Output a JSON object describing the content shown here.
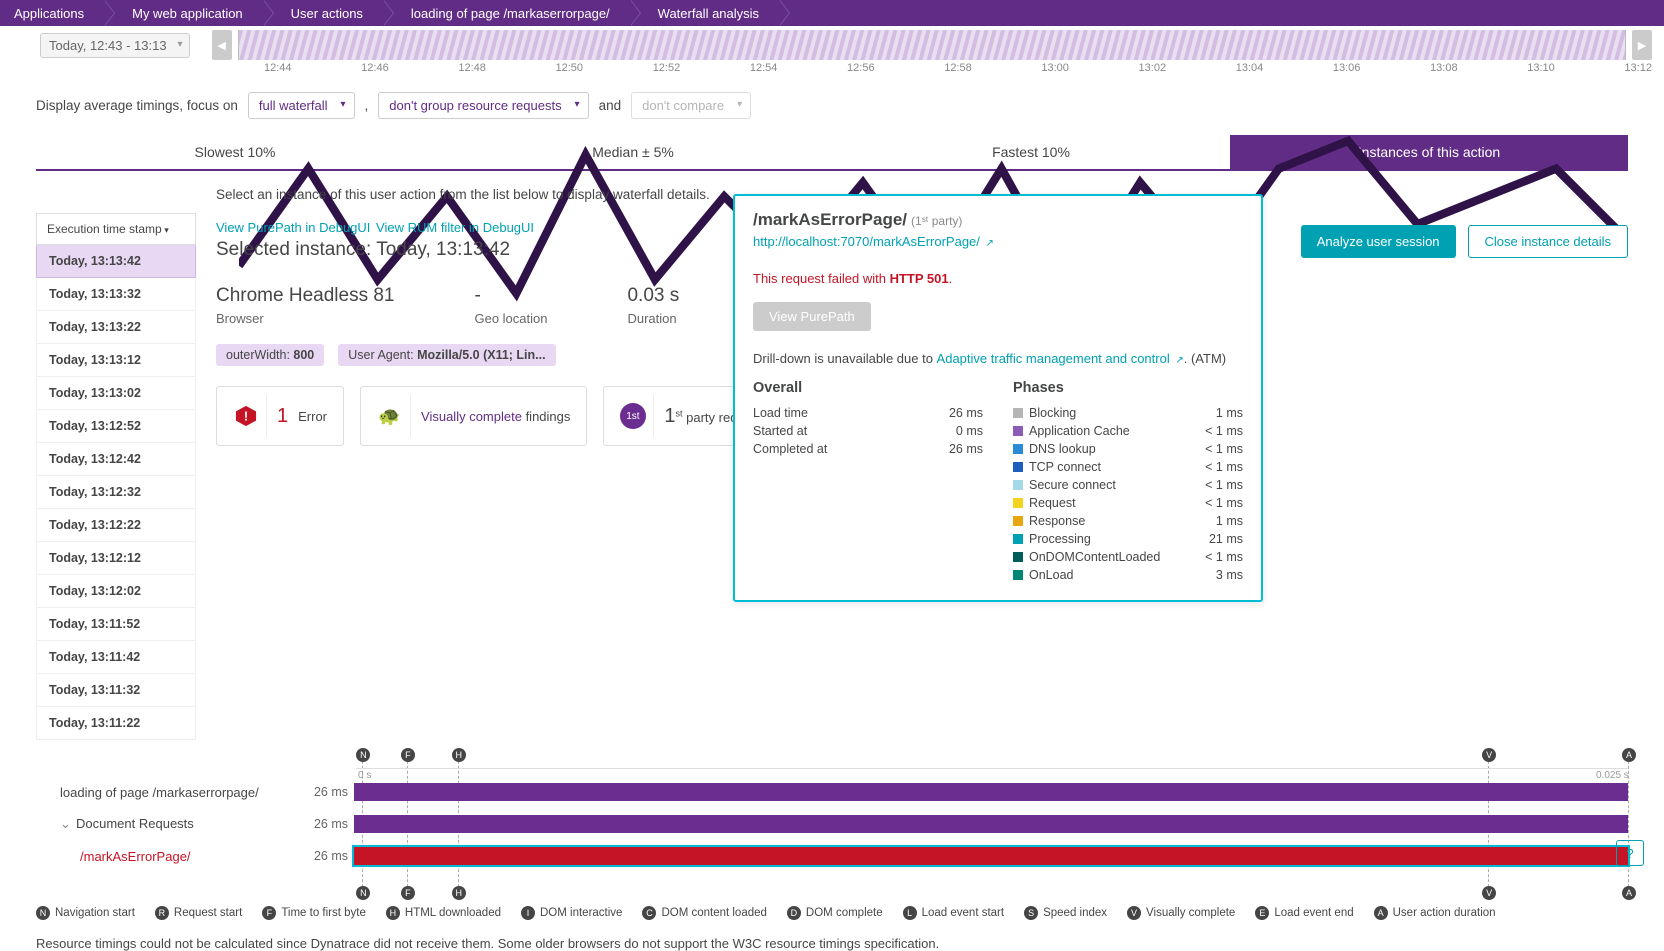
{
  "breadcrumb": [
    "Applications",
    "My web application",
    "User actions",
    "loading of page /markaserrorpage/",
    "Waterfall analysis"
  ],
  "time_selector": "Today, 12:43 - 13:13",
  "time_ticks": [
    "12:44",
    "12:46",
    "12:48",
    "12:50",
    "12:52",
    "12:54",
    "12:56",
    "12:58",
    "13:00",
    "13:02",
    "13:04",
    "13:06",
    "13:08",
    "13:10",
    "13:12"
  ],
  "filter": {
    "prefix": "Display average timings, focus on",
    "waterfall": "full waterfall",
    "group": "don't group resource requests",
    "and": "and",
    "compare": "don't compare",
    "comma": ","
  },
  "tabs": [
    "Slowest 10%",
    "Median ± 5%",
    "Fastest 10%",
    "Instances of this action"
  ],
  "active_tab": 3,
  "instruction": "Select an instance of this user action from the list below to display waterfall details.",
  "list_header": "Execution time stamp",
  "instances": [
    "Today, 13:13:42",
    "Today, 13:13:32",
    "Today, 13:13:22",
    "Today, 13:13:12",
    "Today, 13:13:02",
    "Today, 13:12:52",
    "Today, 13:12:42",
    "Today, 13:12:32",
    "Today, 13:12:22",
    "Today, 13:12:12",
    "Today, 13:12:02",
    "Today, 13:11:52",
    "Today, 13:11:42",
    "Today, 13:11:32",
    "Today, 13:11:22"
  ],
  "selected_index": 0,
  "links": {
    "purepath": "View PurePath in DebugUI",
    "rum": "View RUM filter in DebugUI"
  },
  "selected_label": "Selected instance: Today, 13:13:42",
  "info": {
    "browser_val": "Chrome Headless 81",
    "browser_lbl": "Browser",
    "geo_val": "-",
    "geo_lbl": "Geo location",
    "dur_val": "0.03 s",
    "dur_lbl": "Duration"
  },
  "tags": {
    "outer_key": "outerWidth:",
    "outer_val": "800",
    "ua_key": "User Agent:",
    "ua_val": "Mozilla/5.0 (X11; Lin..."
  },
  "cards": {
    "error_n": "1",
    "error_l": "Error",
    "vc": "Visually complete",
    "vc_sub": "findings",
    "first_badge": "1st",
    "first_count": "1",
    "first_sup": "st",
    "first_txt": " party requests"
  },
  "buttons": {
    "analyze": "Analyze user session",
    "close": "Close instance details",
    "view_pp": "View PurePath"
  },
  "wf": {
    "scale_left": "0 s",
    "scale_right": "0.025 s",
    "r1_label": "loading of page /markaserrorpage/",
    "r1_ms": "26 ms",
    "r2_label": "Document Requests",
    "r2_ms": "26 ms",
    "r3_label": "/markAsErrorPage/",
    "r3_ms": "26 ms",
    "markers": [
      {
        "id": "N",
        "pct": 0.5
      },
      {
        "id": "F",
        "pct": 4
      },
      {
        "id": "H",
        "pct": 8
      },
      {
        "id": "V",
        "pct": 89
      },
      {
        "id": "A",
        "pct": 100
      }
    ]
  },
  "legend": [
    {
      "k": "N",
      "t": "Navigation start"
    },
    {
      "k": "R",
      "t": "Request start"
    },
    {
      "k": "F",
      "t": "Time to first byte"
    },
    {
      "k": "H",
      "t": "HTML downloaded"
    },
    {
      "k": "I",
      "t": "DOM interactive"
    },
    {
      "k": "C",
      "t": "DOM content loaded"
    },
    {
      "k": "D",
      "t": "DOM complete"
    },
    {
      "k": "L",
      "t": "Load event start"
    },
    {
      "k": "S",
      "t": "Speed index"
    },
    {
      "k": "V",
      "t": "Visually complete"
    },
    {
      "k": "E",
      "t": "Load event end"
    },
    {
      "k": "A",
      "t": "User action duration"
    }
  ],
  "footnote": "Resource timings could not be calculated since Dynatrace did not receive them. Some older browsers do not support the W3C resource timings specification.",
  "popup": {
    "title": "/markAsErrorPage/",
    "party": "(1ˢᵗ party)",
    "url": "http://localhost:7070/markAsErrorPage/",
    "fail_prefix": "This request failed with ",
    "fail_code": "HTTP 501",
    "fail_suffix": ".",
    "drill_prefix": "Drill-down is unavailable due to ",
    "drill_link": "Adaptive traffic management and control",
    "drill_suffix": ". (ATM)",
    "overall_h": "Overall",
    "overall": [
      [
        "Load time",
        "26 ms"
      ],
      [
        "Started at",
        "0 ms"
      ],
      [
        "Completed at",
        "26 ms"
      ]
    ],
    "phases_h": "Phases",
    "phases": [
      {
        "c": "#b5b5b5",
        "n": "Blocking",
        "v": "1 ms"
      },
      {
        "c": "#8b5cb5",
        "n": "Application Cache",
        "v": "< 1 ms"
      },
      {
        "c": "#2a8cd6",
        "n": "DNS lookup",
        "v": "< 1 ms"
      },
      {
        "c": "#1d5ec0",
        "n": "TCP connect",
        "v": "< 1 ms"
      },
      {
        "c": "#a4d9ea",
        "n": "Secure connect",
        "v": "< 1 ms"
      },
      {
        "c": "#f4d31f",
        "n": "Request",
        "v": "< 1 ms"
      },
      {
        "c": "#e8a611",
        "n": "Response",
        "v": "1 ms"
      },
      {
        "c": "#00a1b2",
        "n": "Processing",
        "v": "21 ms"
      },
      {
        "c": "#005d59",
        "n": "OnDOMContentLoaded",
        "v": "< 1 ms"
      },
      {
        "c": "#008577",
        "n": "OnLoad",
        "v": "3 ms"
      }
    ]
  }
}
